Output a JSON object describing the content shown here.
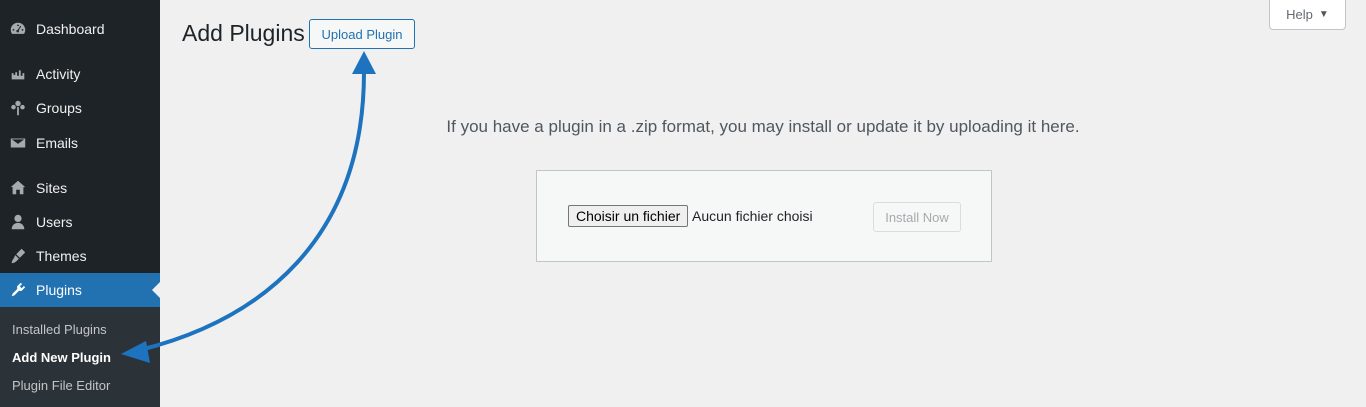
{
  "sidebar": {
    "items": [
      {
        "label": "Dashboard",
        "icon": "dashboard-icon"
      },
      {
        "label": "Activity",
        "icon": "activity-icon"
      },
      {
        "label": "Groups",
        "icon": "groups-icon"
      },
      {
        "label": "Emails",
        "icon": "emails-icon"
      },
      {
        "label": "Sites",
        "icon": "sites-icon"
      },
      {
        "label": "Users",
        "icon": "users-icon"
      },
      {
        "label": "Themes",
        "icon": "themes-icon"
      },
      {
        "label": "Plugins",
        "icon": "plugins-icon",
        "active": true
      }
    ],
    "submenu": [
      {
        "label": "Installed Plugins"
      },
      {
        "label": "Add New Plugin",
        "current": true
      },
      {
        "label": "Plugin File Editor"
      }
    ]
  },
  "header": {
    "title": "Add Plugins",
    "upload_label": "Upload Plugin",
    "help_label": "Help",
    "help_caret": "▼"
  },
  "main": {
    "info_text": "If you have a plugin in a .zip format, you may install or update it by uploading it here.",
    "file_button_label": "Choisir un fichier",
    "file_status": "Aucun fichier choisi",
    "install_label": "Install Now"
  },
  "colors": {
    "sidebar_bg": "#1d2327",
    "accent": "#2271b1",
    "annotation_arrow": "#1e73be"
  }
}
